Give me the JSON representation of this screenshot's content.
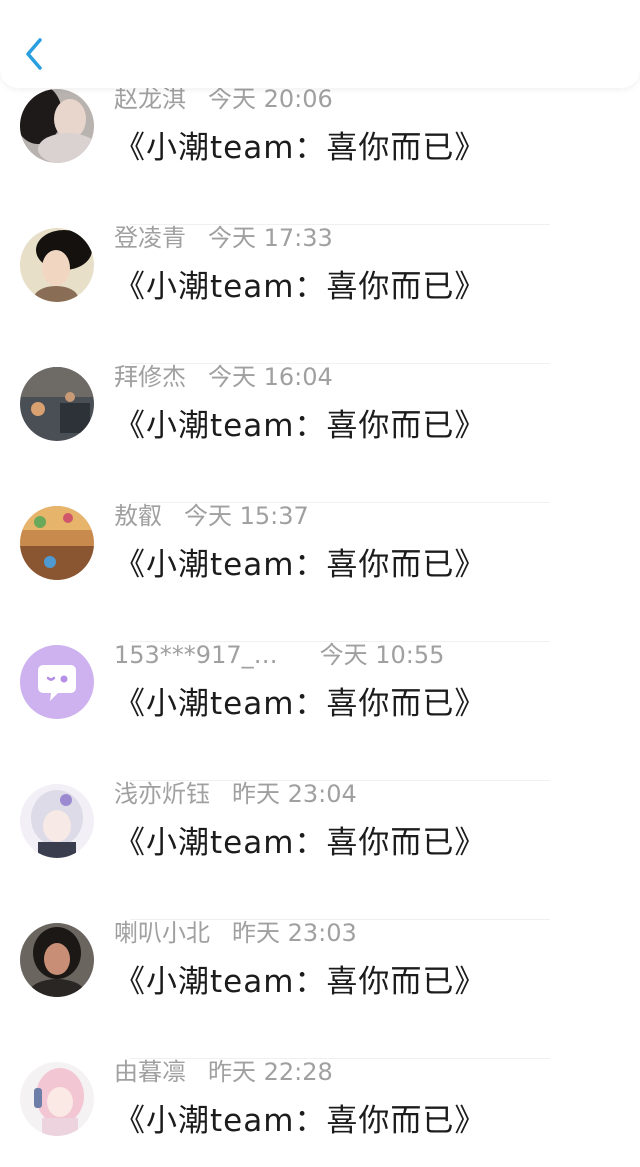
{
  "header": {
    "back_icon": "chevron-left-icon",
    "accent_color": "#2a9fe0"
  },
  "messages": [
    {
      "name": "赵龙淇",
      "time": "今天 20:06",
      "text": "《小潮team：喜你而已》"
    },
    {
      "name": "登凌青",
      "time": "今天 17:33",
      "text": "《小潮team：喜你而已》"
    },
    {
      "name": "拜修杰",
      "time": "今天 16:04",
      "text": "《小潮team：喜你而已》"
    },
    {
      "name": "敖叡",
      "time": "今天 15:37",
      "text": "《小潮team：喜你而已》"
    },
    {
      "name": "153***917_…",
      "time": "今天 10:55",
      "text": "《小潮team：喜你而已》"
    },
    {
      "name": "浅亦炘钰",
      "time": "昨天 23:04",
      "text": "《小潮team：喜你而已》"
    },
    {
      "name": "喇叭小北",
      "time": "昨天 23:03",
      "text": "《小潮team：喜你而已》"
    },
    {
      "name": "由暮凛",
      "time": "昨天 22:28",
      "text": "《小潮team：喜你而已》"
    }
  ]
}
